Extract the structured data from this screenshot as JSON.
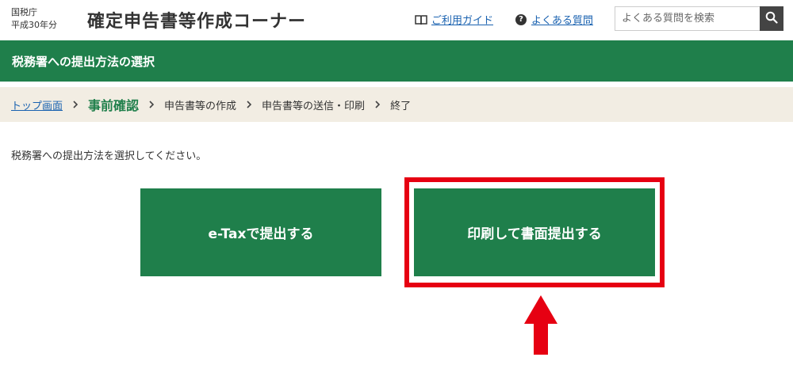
{
  "header": {
    "agency_line1": "国税庁",
    "agency_line2": "平成30年分",
    "site_title": "確定申告書等作成コーナー",
    "guide_link": "ご利用ガイド",
    "faq_link": "よくある質問",
    "search_placeholder": "よくある質問を検索"
  },
  "title_bar": {
    "title": "税務署への提出方法の選択"
  },
  "breadcrumb": {
    "items": [
      "トップ画面",
      "事前確認",
      "申告書等の作成",
      "申告書等の送信・印刷",
      "終了"
    ]
  },
  "main": {
    "instruction": "税務署への提出方法を選択してください。",
    "etax_button": "e-Taxで提出する",
    "print_button": "印刷して書面提出する"
  },
  "colors": {
    "brand_green": "#1f7f4b",
    "highlight_red": "#e60012",
    "breadcrumb_bg": "#f2ede3",
    "link_blue": "#1a62b0"
  },
  "icons": {
    "guide": "book-icon",
    "faq": "question-circle-icon",
    "search": "search-icon",
    "separator": "chevron-right-icon",
    "annotation": "arrow-up-icon"
  }
}
